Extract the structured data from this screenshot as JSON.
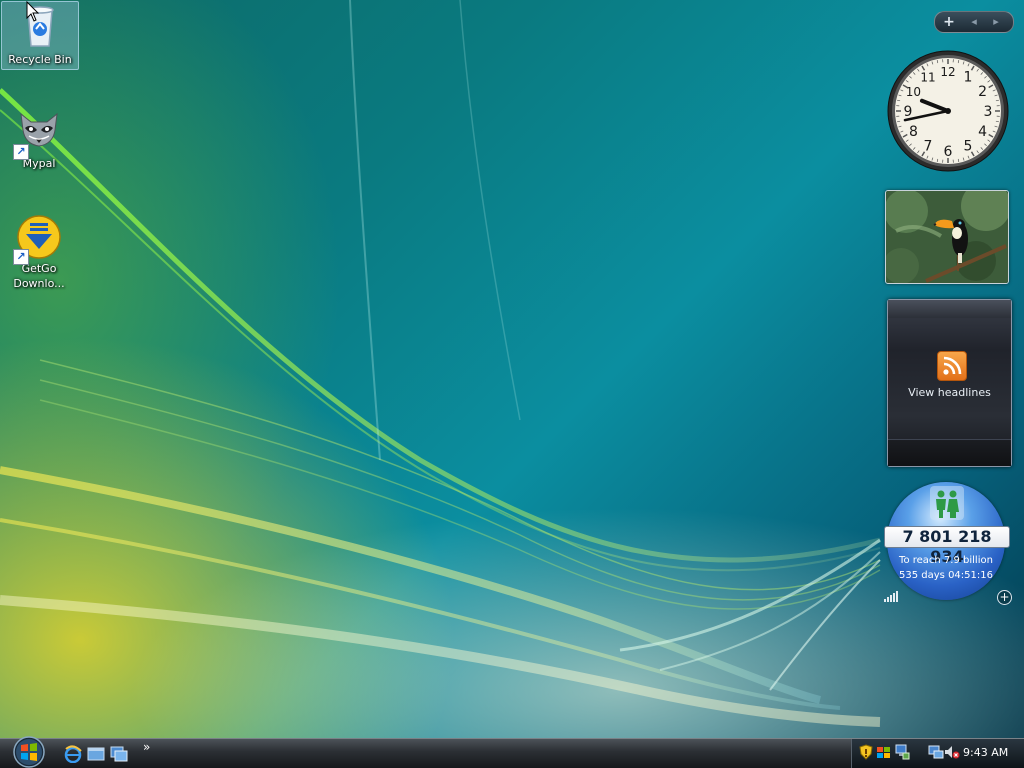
{
  "desktop": {
    "icons": [
      {
        "label": "Recycle Bin",
        "icon": "recycle-bin-icon"
      },
      {
        "label": "Mypal",
        "icon": "raccoon-icon"
      },
      {
        "label": "GetGo Downlo...",
        "icon": "download-arrow-icon"
      }
    ]
  },
  "sidebar": {
    "controls": {
      "add": "+",
      "prev": "◂",
      "next": "▸"
    },
    "clock": {
      "hour": 9,
      "minute": 43,
      "numerals": [
        "12",
        "1",
        "2",
        "3",
        "4",
        "5",
        "6",
        "7",
        "8",
        "9",
        "10",
        "11"
      ]
    },
    "slideshow": {
      "subject": "toucan-photo"
    },
    "feed": {
      "label": "View headlines",
      "icon": "rss-icon"
    },
    "population": {
      "count": "7 801 218 934",
      "target": "To reach 7.9 billion",
      "countdown": "535 days 04:51:16",
      "add_button": "+"
    }
  },
  "taskbar": {
    "start_icon": "windows-logo-icon",
    "quick_launch": [
      {
        "name": "internet-explorer-icon"
      },
      {
        "name": "show-desktop-icon"
      },
      {
        "name": "switch-windows-icon"
      }
    ],
    "overflow": "»",
    "tray": {
      "icons": [
        "security-shield-icon",
        "windows-update-icon",
        "network-icon",
        "network-monitor-icon",
        "volume-muted-icon"
      ],
      "time": "9:43 AM"
    }
  },
  "colors": {
    "wallpaper_teal": "#0b8ea0",
    "wallpaper_green": "#6fd43a",
    "wallpaper_yellow": "#e8d82a",
    "taskbar": "#1b1e22"
  }
}
